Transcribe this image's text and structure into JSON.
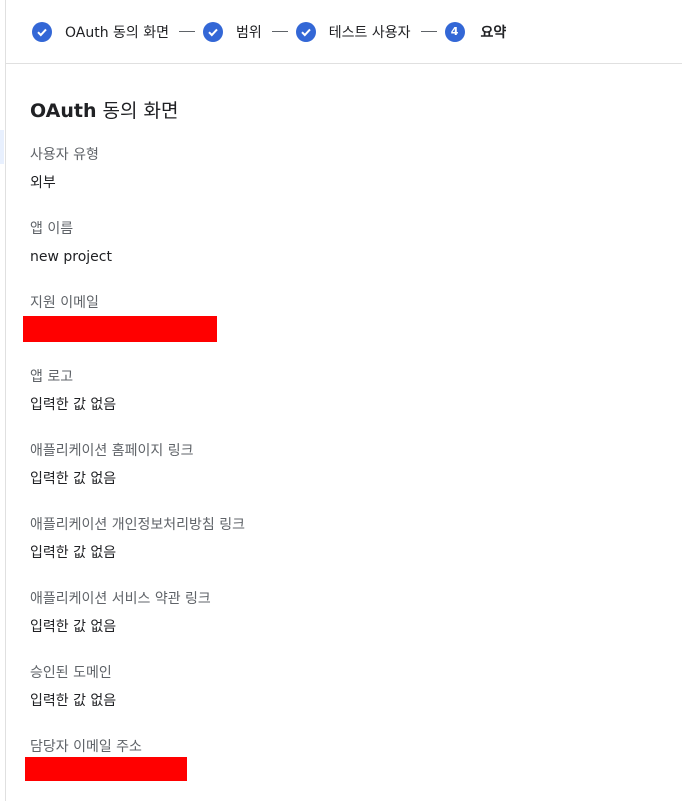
{
  "stepper": {
    "steps": [
      {
        "label": "OAuth 동의 화면",
        "state": "complete"
      },
      {
        "label": "범위",
        "state": "complete"
      },
      {
        "label": "테스트 사용자",
        "state": "complete"
      },
      {
        "label": "요약",
        "number": "4",
        "state": "active"
      }
    ]
  },
  "summary": {
    "title_bold": "OAuth",
    "title_rest": " 동의 화면",
    "fields": [
      {
        "label": "사용자 유형",
        "value": "외부"
      },
      {
        "label": "앱 이름",
        "value": "new project"
      },
      {
        "label": "지원 이메일",
        "value": ""
      },
      {
        "label": "앱 로고",
        "value": "입력한 값 없음"
      },
      {
        "label": "애플리케이션 홈페이지 링크",
        "value": "입력한 값 없음"
      },
      {
        "label": "애플리케이션 개인정보처리방침 링크",
        "value": "입력한 값 없음"
      },
      {
        "label": "애플리케이션 서비스 약관 링크",
        "value": "입력한 값 없음"
      },
      {
        "label": "승인된 도메인",
        "value": "입력한 값 없음"
      },
      {
        "label": "담당자 이메일 주소",
        "value": ""
      }
    ]
  },
  "colors": {
    "accent": "#3367d6",
    "redaction": "#ff0000",
    "label_gray": "#5f6368"
  }
}
